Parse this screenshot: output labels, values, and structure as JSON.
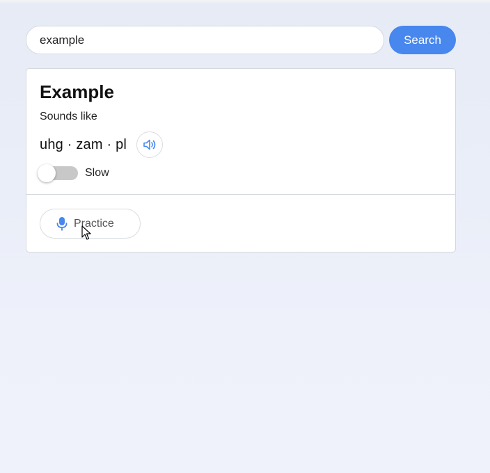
{
  "search": {
    "value": "example",
    "button_label": "Search"
  },
  "card": {
    "title": "Example",
    "sounds_like_label": "Sounds like",
    "phonetic": "uhg · zam · pl",
    "audio_icon": "speaker-icon",
    "slow_toggle": {
      "label": "Slow",
      "on": false
    },
    "practice": {
      "label": "Practice",
      "icon": "microphone-icon"
    }
  },
  "colors": {
    "accent": "#4787ee",
    "toggle_track_off": "#c8c8c8",
    "card_border": "#d5d8dc"
  }
}
